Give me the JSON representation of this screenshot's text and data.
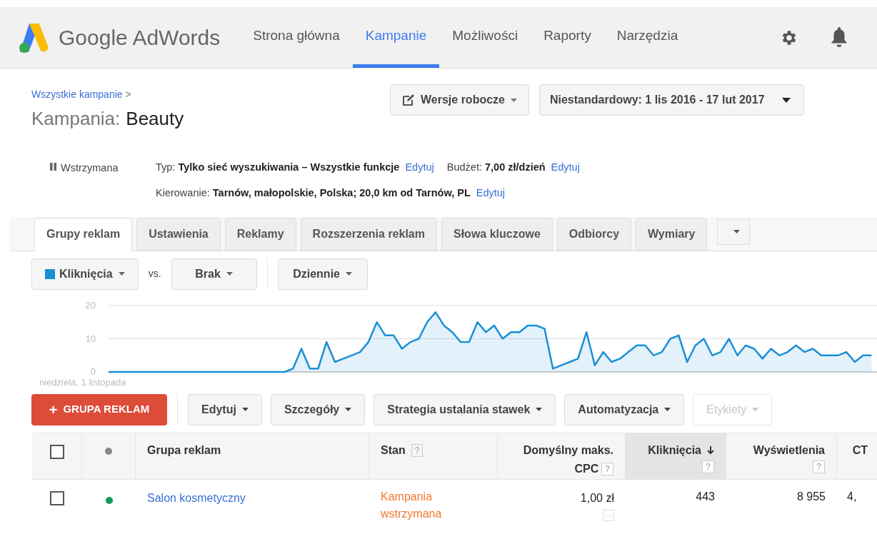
{
  "header": {
    "logo_text": "Google AdWords",
    "nav": [
      {
        "label": "Strona główna",
        "selected": false
      },
      {
        "label": "Kampanie",
        "selected": true
      },
      {
        "label": "Możliwości",
        "selected": false
      },
      {
        "label": "Raporty",
        "selected": false
      },
      {
        "label": "Narzędzia",
        "selected": false
      }
    ]
  },
  "breadcrumb": {
    "link": "Wszystkie kampanie",
    "separator": ">"
  },
  "title": {
    "prefix": "Kampania:",
    "name": "Beauty"
  },
  "drafts_button": "Wersje robocze",
  "date_range": "Niestandardowy: 1 lis 2016 - 17 lut 2017",
  "status": "Wstrzymana",
  "info_rows": [
    [
      {
        "label": "Typ:",
        "value": "Tylko sieć wyszukiwania – Wszystkie funkcje",
        "link": "Edytuj"
      },
      {
        "label": "Budżet:",
        "value": "7,00 zł/dzień",
        "link": "Edytuj"
      }
    ],
    [
      {
        "label": "Kierowanie:",
        "value": "Tarnów, małopolskie, Polska; 20,0 km od Tarnów, PL",
        "link": "Edytuj"
      }
    ]
  ],
  "tabs": [
    {
      "label": "Grupy reklam",
      "selected": true
    },
    {
      "label": "Ustawienia",
      "selected": false
    },
    {
      "label": "Reklamy",
      "selected": false
    },
    {
      "label": "Rozszerzenia reklam",
      "selected": false
    },
    {
      "label": "Słowa kluczowe",
      "selected": false
    },
    {
      "label": "Odbiorcy",
      "selected": false
    },
    {
      "label": "Wymiary",
      "selected": false
    }
  ],
  "chart_controls": {
    "metric": "Kliknięcia",
    "vs": "vs.",
    "compare": "Brak",
    "period": "Dziennie"
  },
  "chart_start_label": "niedziela, 1 listopada",
  "chart_data": {
    "type": "area",
    "ylim": [
      0,
      20
    ],
    "yticks": [
      0,
      10,
      20
    ],
    "series": [
      {
        "color": "#1a8fd6",
        "values": [
          0,
          0,
          0,
          0,
          0,
          0,
          0,
          0,
          0,
          0,
          0,
          0,
          0,
          0,
          0,
          0,
          0,
          0,
          0,
          0,
          0,
          0,
          1,
          7,
          1,
          1,
          9,
          3,
          4,
          5,
          6,
          9,
          15,
          11,
          11,
          7,
          9,
          10,
          15,
          18,
          14,
          12,
          9,
          9,
          15,
          12,
          14,
          10,
          12,
          12,
          14,
          14,
          13,
          1,
          2,
          3,
          4,
          12,
          2,
          6,
          3,
          4,
          6,
          8,
          8,
          5,
          6,
          10,
          11,
          3,
          8,
          10,
          5,
          6,
          10,
          5,
          8,
          7,
          4,
          7,
          5,
          6,
          8,
          6,
          7,
          5,
          5,
          5,
          6,
          3,
          5,
          5
        ]
      }
    ]
  },
  "toolbar": {
    "add_button": "GRUPA REKLAM",
    "add_symbol": "+",
    "buttons": [
      {
        "label": "Edytuj",
        "disabled": false
      },
      {
        "label": "Szczegóły",
        "disabled": false
      },
      {
        "label": "Strategia ustalania stawek",
        "disabled": false
      },
      {
        "label": "Automatyzacja",
        "disabled": false
      },
      {
        "label": "Etykiety",
        "disabled": true
      }
    ]
  },
  "table": {
    "select_all": false,
    "columns": [
      {
        "kind": "checkbox"
      },
      {
        "kind": "dot"
      },
      {
        "kind": "text",
        "label": "Grupa reklam",
        "sorted": false
      },
      {
        "kind": "text",
        "label": "Stan",
        "help": "?",
        "sorted": false
      },
      {
        "kind": "number",
        "label": "Domyślny maks.",
        "label2": "CPC",
        "help": "?",
        "sorted": false
      },
      {
        "kind": "number",
        "label": "Kliknięcia",
        "help": "?",
        "sorted": true
      },
      {
        "kind": "number",
        "label": "Wyświetlenia",
        "help": "?",
        "sorted": false
      },
      {
        "kind": "number",
        "label": "CT",
        "sorted": false
      }
    ],
    "rows": [
      {
        "checked": false,
        "color": "#0f9d58",
        "name": "Salon kosmetyczny",
        "status": "Kampania wstrzymana",
        "cpc": "1,00 zł",
        "clicks": "443",
        "impressions": "8 955",
        "ctr": "4,"
      }
    ]
  }
}
